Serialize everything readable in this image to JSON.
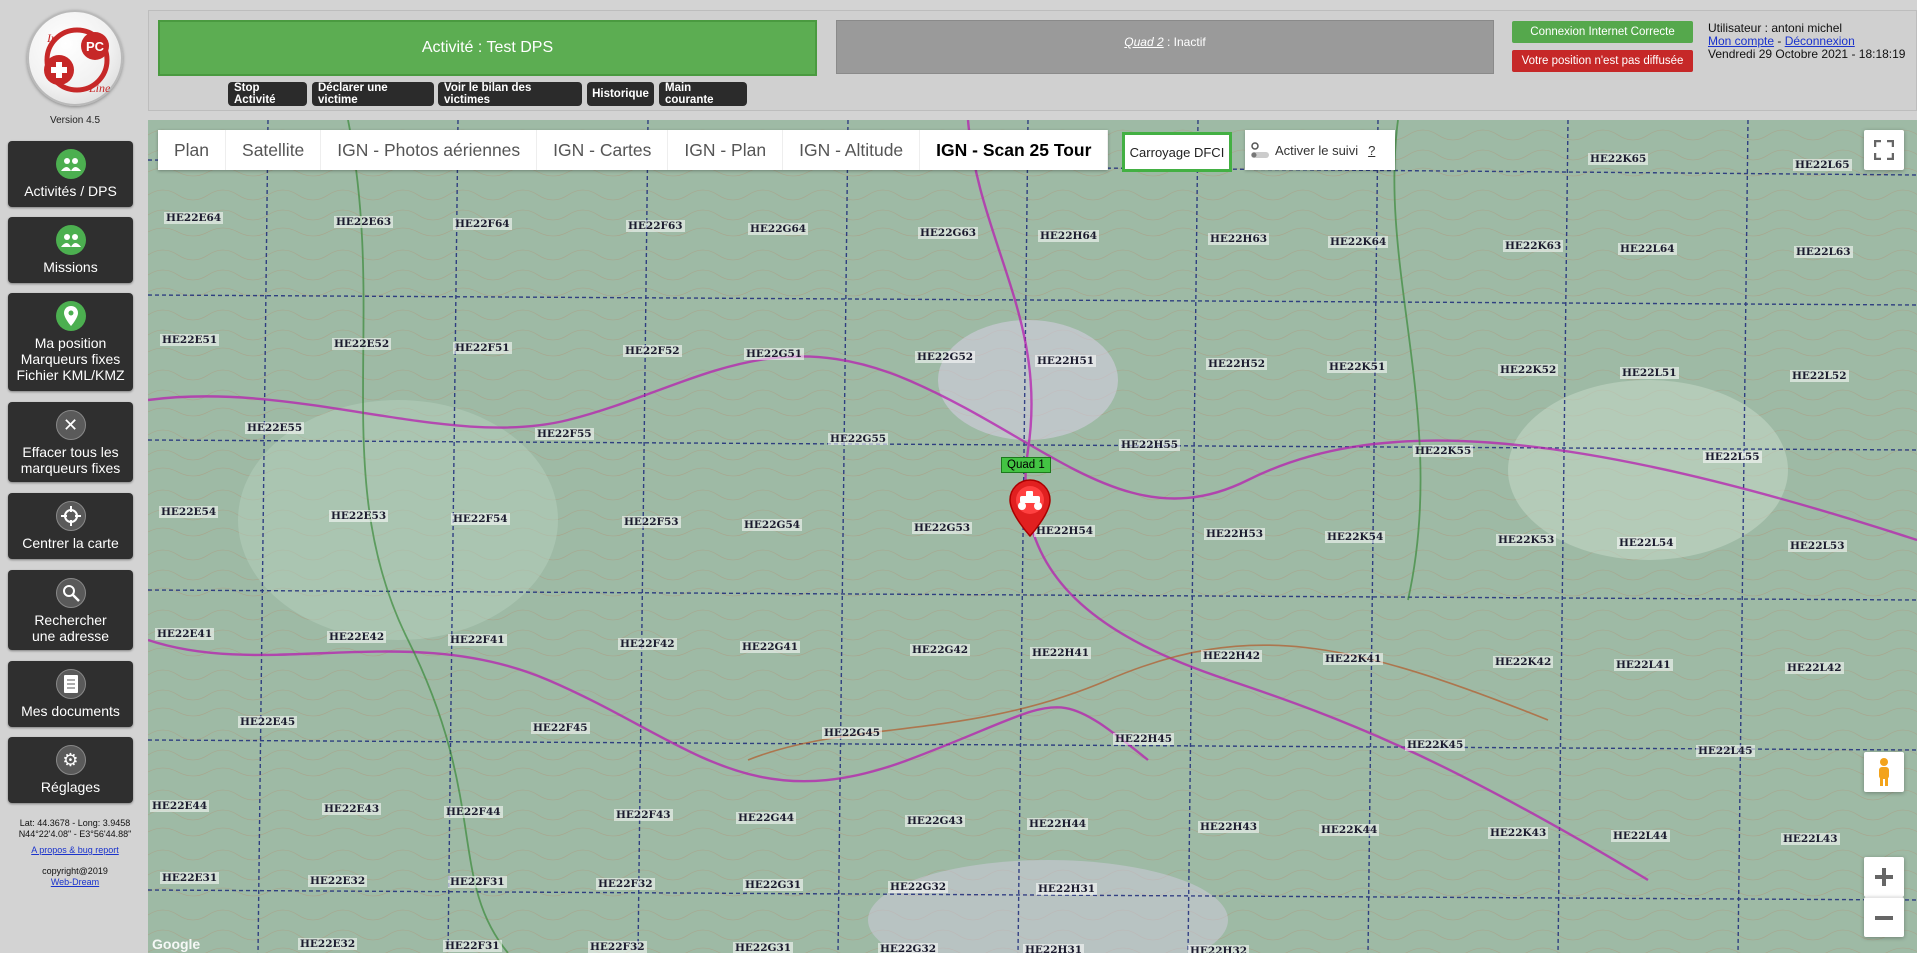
{
  "sidebar": {
    "logo": {
      "text_in": "In",
      "text_pc": "PC",
      "text_line": "Line"
    },
    "version": "Version 4.5",
    "buttons": [
      {
        "label": "Activités / DPS",
        "icon": "group-icon"
      },
      {
        "label": "Missions",
        "icon": "group-icon"
      },
      {
        "label": "Ma position\nMarqueurs fixes\nFichier KML/KMZ",
        "icon": "location-pin-icon"
      },
      {
        "label": "Effacer tous les\nmarqueurs fixes",
        "icon": "close-icon"
      },
      {
        "label": "Centrer la carte",
        "icon": "crosshair-icon"
      },
      {
        "label": "Rechercher\nune adresse",
        "icon": "search-icon"
      },
      {
        "label": "Mes documents",
        "icon": "document-icon"
      },
      {
        "label": "Réglages",
        "icon": "gears-icon"
      }
    ],
    "coords_line1": "Lat: 44.3678 - Long: 3.9458",
    "coords_line2": "N44°22'4.08\" - E3°56'44.88\"",
    "bug_link": "A propos & bug report",
    "copyright": "copyright@2019",
    "webdream": "Web-Dream"
  },
  "header": {
    "activity": "Activité : Test DPS",
    "quad_name": "Quad 2",
    "quad_status": " : Inactif",
    "actions": [
      "Stop Activité",
      "Déclarer une victime",
      "Voir le bilan des victimes",
      "Historique",
      "Main courante"
    ],
    "status_internet": "Connexion Internet Correcte",
    "status_position": "Votre position n'est pas diffusée",
    "user": "Utilisateur : antoni michel",
    "mon_compte": "Mon compte",
    "separator": " - ",
    "deconnexion": "Déconnexion",
    "datetime": "Vendredi 29 Octobre 2021 - 18:18:19"
  },
  "map": {
    "tabs": [
      "Plan",
      "Satellite",
      "IGN - Photos aériennes",
      "IGN - Cartes",
      "IGN - Plan",
      "IGN - Altitude",
      "IGN - Scan 25 Tour"
    ],
    "active_tab": "IGN - Scan 25 Tour",
    "carroyage": "Carroyage DFCI",
    "suivi": "Activer le suivi",
    "help": "?",
    "marker_label": "Quad 1",
    "google": "Google",
    "grid_labels": [
      "HE22K65",
      "HE22L65",
      "HE22E64",
      "HE22E63",
      "HE22F64",
      "HE22F63",
      "HE22G64",
      "HE22G63",
      "HE22H64",
      "HE22H63",
      "HE22K64",
      "HE22K63",
      "HE22L64",
      "HE22L63",
      "HE22E51",
      "HE22E52",
      "HE22F51",
      "HE22F52",
      "HE22G51",
      "HE22G52",
      "HE22H51",
      "HE22H52",
      "HE22K51",
      "HE22K52",
      "HE22L51",
      "HE22L52",
      "HE22E55",
      "HE22F55",
      "HE22G55",
      "HE22H55",
      "HE22K55",
      "HE22L55",
      "HE22E54",
      "HE22E53",
      "HE22F54",
      "HE22F53",
      "HE22G54",
      "HE22G53",
      "HE22H54",
      "HE22H53",
      "HE22K54",
      "HE22K53",
      "HE22L54",
      "HE22L53",
      "HE22E41",
      "HE22E42",
      "HE22F41",
      "HE22F42",
      "HE22G41",
      "HE22G42",
      "HE22H41",
      "HE22H42",
      "HE22K41",
      "HE22K42",
      "HE22L41",
      "HE22L42",
      "HE22E45",
      "HE22F45",
      "HE22G45",
      "HE22H45",
      "HE22K45",
      "HE22L45",
      "HE22E44",
      "HE22E43",
      "HE22F44",
      "HE22F43",
      "HE22G44",
      "HE22G43",
      "HE22H44",
      "HE22H43",
      "HE22K44",
      "HE22K43",
      "HE22L44",
      "HE22L43",
      "HE22E31",
      "HE22E32",
      "HE22F31",
      "HE22F32",
      "HE22G31",
      "HE22G32",
      "HE22H31",
      "HE22E32",
      "HE22F31",
      "HE22F32",
      "HE22G31",
      "HE22G32",
      "HE22H31",
      "HE22H32"
    ]
  },
  "colors": {
    "green": "#5cad52",
    "red": "#c62828",
    "dark_button": "#2b2b2b"
  }
}
